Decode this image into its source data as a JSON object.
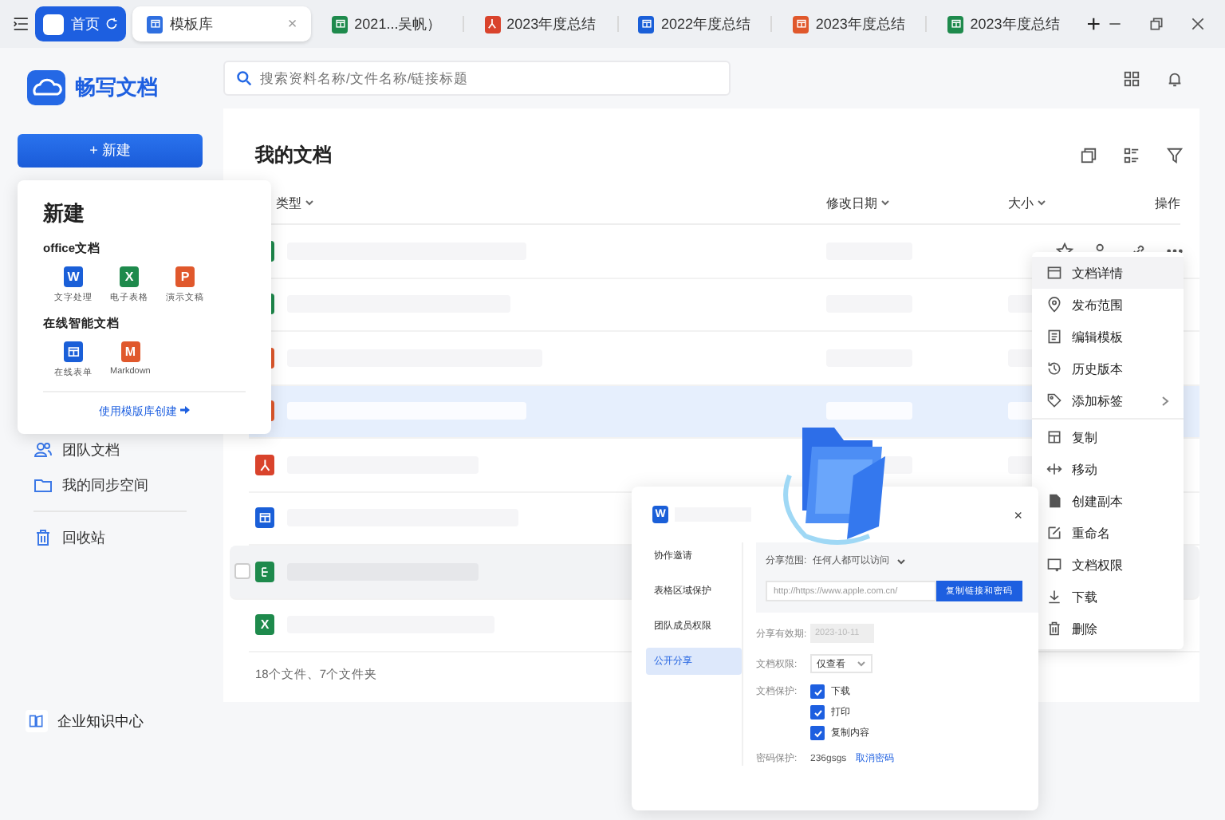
{
  "top_bar": {
    "home_tab": {
      "label": "首页"
    },
    "tabs": [
      {
        "label": "模板库",
        "kind": "template",
        "selected": true,
        "close": "×"
      },
      {
        "label": "2021...吴帆）",
        "kind": "excel",
        "selected": false
      },
      {
        "label": "2023年度总结",
        "kind": "pdf",
        "selected": false
      },
      {
        "label": "2022年度总结",
        "kind": "word",
        "selected": false
      },
      {
        "label": "2023年度总结",
        "kind": "ppt",
        "selected": false
      },
      {
        "label": "2023年度总结",
        "kind": "sheet",
        "selected": false
      }
    ],
    "new_tab": "+"
  },
  "sidebar": {
    "app_name": "畅写文档",
    "new_button": "+ 新建",
    "items": [
      {
        "label": "团队文档",
        "kind": "team"
      },
      {
        "label": "我的同步空间",
        "kind": "folder"
      },
      {
        "label": "回收站",
        "kind": "trash"
      }
    ],
    "footer": "企业知识中心"
  },
  "search": {
    "placeholder": "搜索资料名称/文件名称/链接标题"
  },
  "documents": {
    "title": "我的文档",
    "columns": [
      "类型",
      "修改日期",
      "大小",
      "操作"
    ],
    "rows": [
      {
        "kind": "excel",
        "selected": false,
        "hovered": false,
        "actions": true
      },
      {
        "kind": "excel",
        "selected": false,
        "hovered": false
      },
      {
        "kind": "ppt",
        "selected": false,
        "hovered": false
      },
      {
        "kind": "ppt",
        "selected": true,
        "hovered": false
      },
      {
        "kind": "pdf",
        "selected": false,
        "hovered": false
      },
      {
        "kind": "form",
        "selected": false,
        "hovered": false
      },
      {
        "kind": "mindmap",
        "selected": false,
        "hovered": true
      },
      {
        "kind": "excel",
        "letter": "X",
        "selected": false,
        "hovered": false
      }
    ],
    "footer": "18个文件、7个文件夹"
  },
  "new_popup": {
    "title": "新建",
    "sections": [
      {
        "title": "office文档",
        "items": [
          {
            "label": "文字处理",
            "kind": "word",
            "letter": "W"
          },
          {
            "label": "电子表格",
            "kind": "excel",
            "letter": "X"
          },
          {
            "label": "演示文稿",
            "kind": "ppt",
            "letter": "P"
          }
        ]
      },
      {
        "title": "在线智能文档",
        "items": [
          {
            "label": "在线表单",
            "kind": "form"
          },
          {
            "label": "Markdown",
            "kind": "markdown",
            "letter": "M"
          }
        ]
      }
    ],
    "link": "使用模版库创建"
  },
  "context_menu": {
    "groups": [
      [
        {
          "label": "文档详情",
          "selected": true,
          "submenu": false
        },
        {
          "label": "发布范围",
          "selected": false,
          "submenu": false
        },
        {
          "label": "编辑模板",
          "selected": false,
          "submenu": false
        },
        {
          "label": "历史版本",
          "selected": false,
          "submenu": false
        },
        {
          "label": "添加标签",
          "selected": false,
          "submenu": true
        }
      ],
      [
        {
          "label": "复制",
          "selected": false,
          "submenu": false
        },
        {
          "label": "移动",
          "selected": false,
          "submenu": false
        },
        {
          "label": "创建副本",
          "selected": false,
          "submenu": false
        },
        {
          "label": "重命名",
          "selected": false,
          "submenu": false
        },
        {
          "label": "文档权限",
          "selected": false,
          "submenu": false
        },
        {
          "label": "下载",
          "selected": false,
          "submenu": false
        },
        {
          "label": "删除",
          "selected": false,
          "submenu": false
        }
      ]
    ]
  },
  "share_dialog": {
    "file_letter": "W",
    "close": "×",
    "nav": [
      {
        "label": "协作邀请",
        "selected": false
      },
      {
        "label": "表格区域保护",
        "selected": false
      },
      {
        "label": "团队成员权限",
        "selected": false
      },
      {
        "label": "公开分享",
        "selected": true
      }
    ],
    "scope_label": "分享范围:",
    "scope_value": "任何人都可以访问",
    "link_value": "http://https://www.apple.com.cn/",
    "copy_button": "复制链接和密码",
    "expiry_label": "分享有效期:",
    "expiry_value": "2023-10-11",
    "expiry_disabled": true,
    "permission_label": "文档权限:",
    "permission_value": "仅查看",
    "protection_label": "文档保护:",
    "protections": [
      {
        "label": "下载",
        "checked": true
      },
      {
        "label": "打印",
        "checked": true
      },
      {
        "label": "复制内容",
        "checked": true
      }
    ],
    "password_label": "密码保护:",
    "password_value": "236gsgs",
    "cancel_password": "取消密码"
  }
}
